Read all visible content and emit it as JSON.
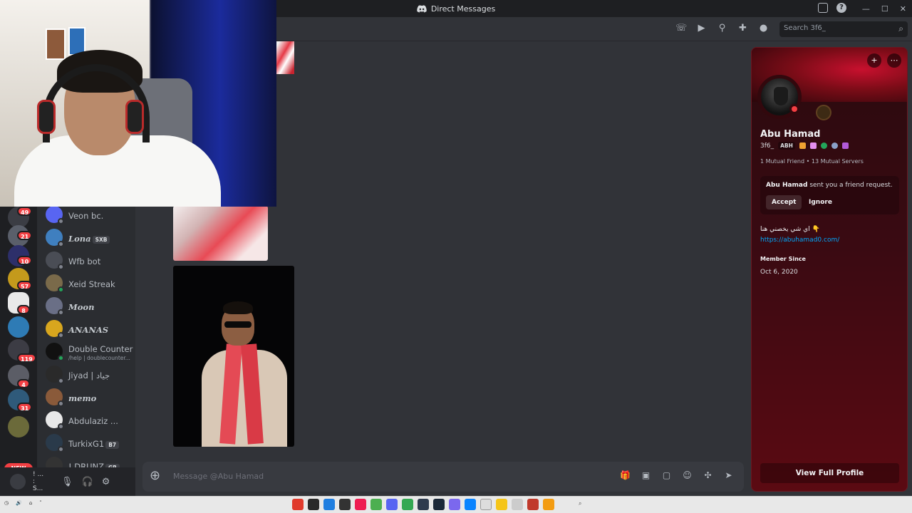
{
  "window": {
    "title": "Direct Messages"
  },
  "header": {
    "search_placeholder": "Search 3f6_"
  },
  "rail": {
    "badges": [
      "49",
      "21",
      "10",
      "57",
      "8",
      "119",
      "4",
      "31"
    ],
    "new_label": "NEW"
  },
  "dms": [
    {
      "name": "Veon bc.",
      "tag": "",
      "sub": "",
      "color": "#5865f2",
      "status": "#80848e",
      "bold": false
    },
    {
      "name": "Lona",
      "tag": "SXB",
      "sub": "",
      "color": "#3f7fbf",
      "status": "#80848e",
      "bold": true
    },
    {
      "name": "Wfb bot",
      "tag": "",
      "sub": "",
      "color": "#4a4d55",
      "status": "#80848e",
      "bold": false
    },
    {
      "name": "Xeid Streak",
      "tag": "",
      "sub": "",
      "color": "#7a6a4a",
      "status": "#23a55a",
      "bold": false
    },
    {
      "name": "Moon",
      "tag": "",
      "sub": "",
      "color": "#6a6f86",
      "status": "#80848e",
      "bold": true
    },
    {
      "name": "ANANAS",
      "tag": "",
      "sub": "",
      "color": "#d8a61e",
      "status": "#80848e",
      "bold": true
    },
    {
      "name": "Double Counter",
      "tag": "",
      "sub": "/help | doublecounter...",
      "color": "#111111",
      "status": "#23a55a",
      "bold": false
    },
    {
      "name": "Jiyad | جياد",
      "tag": "",
      "sub": "",
      "color": "#2a2a2a",
      "status": "#80848e",
      "bold": false
    },
    {
      "name": "memo",
      "tag": "",
      "sub": "",
      "color": "#8a5a3a",
      "status": "#80848e",
      "bold": true
    },
    {
      "name": "Abdulaziz ...",
      "tag": "",
      "sub": "",
      "color": "#e8e8e8",
      "status": "#80848e",
      "bold": false
    },
    {
      "name": "TurkixG1",
      "tag": "B7",
      "sub": "",
      "color": "#2a3a4a",
      "status": "#80848e",
      "bold": false
    },
    {
      "name": "! DRUNZ",
      "tag": "GR",
      "sub": "",
      "color": "#333333",
      "status": "#80848e",
      "bold": false
    }
  ],
  "user_panel": {
    "name": "! ...",
    "status": ": S..."
  },
  "composer": {
    "placeholder": "Message @Abu Hamad"
  },
  "profile": {
    "display_name": "Abu Hamad",
    "username": "3f6_",
    "guild_tag": "ABH",
    "mutual": "1 Mutual Friend • 13 Mutual Servers",
    "request_name": "Abu Hamad",
    "request_text": " sent you a friend request.",
    "accept": "Accept",
    "ignore": "Ignore",
    "bio": "اي شي يخصني هنا 👇",
    "link": "https://abuhamad0.com/",
    "member_since_label": "Member Since",
    "member_since": "Oct 6, 2020",
    "full_profile": "View Full Profile",
    "accent": "#c8102e"
  }
}
